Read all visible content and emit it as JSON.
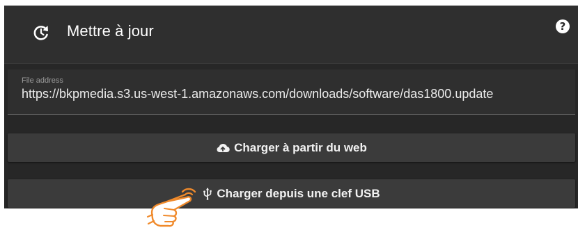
{
  "header": {
    "title": "Mettre à jour",
    "refresh_icon": "refresh-icon",
    "help_icon": "?"
  },
  "file_field": {
    "label": "File address",
    "value": "https://bkpmedia.s3.us-west-1.amazonaws.com/downloads/software/das1800.update"
  },
  "buttons": {
    "web": {
      "label": "Charger à partir du web",
      "icon": "cloud-upload-icon"
    },
    "usb": {
      "label": "Charger depuis une clef USB",
      "icon": "usb-icon"
    }
  },
  "colors": {
    "panel_bg": "#272727",
    "header_bg": "#2f2f2f",
    "button_bg": "#3b3b3b",
    "hand_accent": "#f08a2b"
  }
}
